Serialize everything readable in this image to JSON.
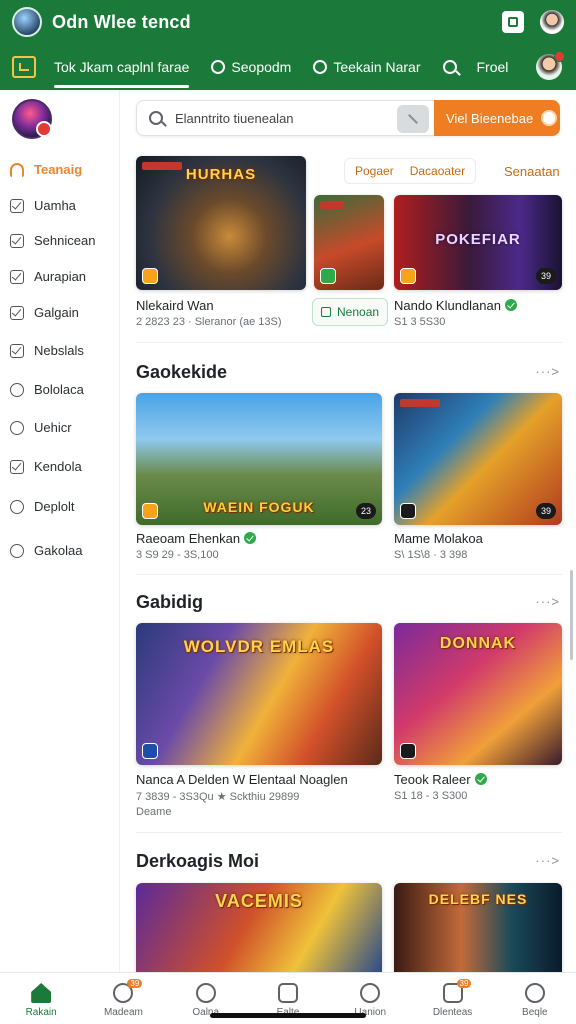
{
  "status": {
    "title": "Odn Wlee tencd"
  },
  "topbar": {
    "tabs": [
      {
        "label": "Tok  Jkam caplnl  farae",
        "active": true
      },
      {
        "label": "Seopodm"
      },
      {
        "label": "Teekain Narar"
      },
      {
        "label": "Froel"
      }
    ]
  },
  "sidebar": {
    "items": [
      {
        "label": "Teanaig",
        "active": true
      },
      {
        "label": "Uamha"
      },
      {
        "label": "Sehnicean"
      },
      {
        "label": "Aurapian"
      },
      {
        "label": "Galgain"
      },
      {
        "label": "Nebslals"
      },
      {
        "label": "Bololaca"
      },
      {
        "label": "Uehicr"
      },
      {
        "label": "Kendola"
      },
      {
        "label": "Deplolt"
      },
      {
        "label": "Gakolaa"
      }
    ]
  },
  "search": {
    "placeholder": "Elanntrito tiuenealan",
    "visit_label": "Viel Bieenebae"
  },
  "featured": {
    "pill_left": "Pogaer",
    "pill_right": "Dacaoater",
    "link_right": "Senaatan",
    "card1": {
      "logo": "HURHAS",
      "title": "Nlekaird Wan",
      "meta": "2 2823 23 · Sleranor (ae 13S)"
    },
    "button": "Nenoan",
    "card3": {
      "logo": "POKEFIAR",
      "title": "Nando Klundlanan",
      "meta": "S1 3 5S30",
      "badge": "39"
    }
  },
  "sections": [
    {
      "title": "Gaokekide",
      "more": "···>",
      "cards": [
        {
          "logo": "WAEIN FOGUK",
          "title": "Raeoam Ehenkan",
          "meta": "3 S9 29 - 3S,100",
          "badge": "23"
        },
        {
          "title": "Mame Molakoa",
          "meta": "S\\ 1S\\8 · 3 398",
          "badge": "39"
        }
      ]
    },
    {
      "title": "Gabidig",
      "more": "···>",
      "cards": [
        {
          "logo": "WOLVDR EMLAS",
          "title": "Nanca A Delden W Elentaal Noaglen",
          "meta": "7 3839 - 3S3Qu ★ Sckthiu 29899",
          "extra": "Deame"
        },
        {
          "title": "Teook Raleer",
          "meta": "S1 18 - 3 S300",
          "logo": "DONNAK"
        }
      ]
    },
    {
      "title": "Derkoagis Moi",
      "more": "···>",
      "cards": [
        {
          "logo": "VACEMIS"
        },
        {
          "logo": "DELEBF NES"
        }
      ]
    }
  ],
  "bottomnav": [
    {
      "label": "Rakain",
      "active": true
    },
    {
      "label": "Madeam",
      "badge": "39"
    },
    {
      "label": "Oalna"
    },
    {
      "label": "Ealte"
    },
    {
      "label": "Uanion"
    },
    {
      "label": "Dlenteas",
      "badge": "39"
    },
    {
      "label": "Beqle"
    }
  ],
  "colors": {
    "brand_green": "#1b7a3a",
    "accent_orange": "#ef7d22"
  }
}
